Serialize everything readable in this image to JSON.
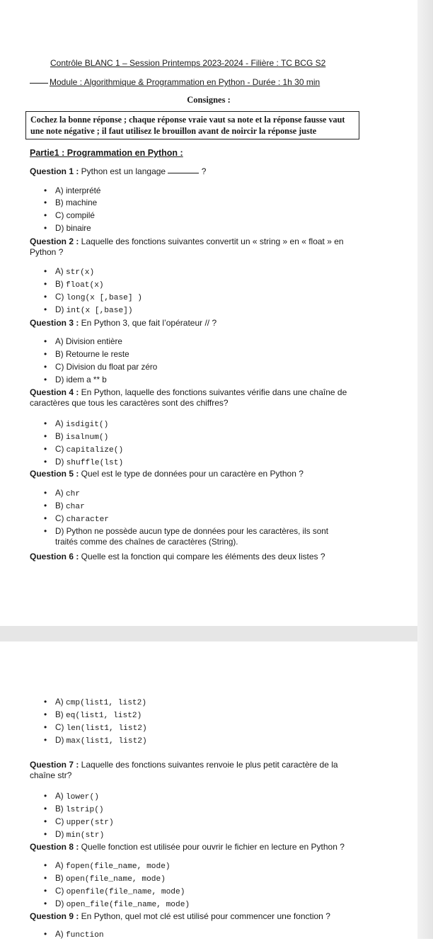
{
  "header": {
    "line1": "Contrôle BLANC 1 – Session Printemps 2023-2024 - Filière : TC BCG S2",
    "line2": "Module : Algorithmique & Programmation en Python - Durée : 1h 30 min",
    "consignes_title": "Consignes :",
    "consignes_text": "Cochez la bonne réponse ; chaque réponse vraie vaut sa note et la réponse fausse vaut une note négative ; il faut utilisez le brouillon avant de noircir la réponse juste"
  },
  "part_title": "Partie1 : Programmation en Python :",
  "questions": [
    {
      "label": "Question 1 :",
      "text_a": " Python est un langage",
      "text_b": " ?",
      "options": [
        {
          "prefix": "A) ",
          "text": "interprété"
        },
        {
          "prefix": "B) ",
          "text": "machine"
        },
        {
          "prefix": "C) ",
          "text": "compilé"
        },
        {
          "prefix": "D) ",
          "text": "binaire"
        }
      ]
    },
    {
      "label": "Question 2 :",
      "text": " Laquelle des fonctions suivantes convertit un « string » en « float » en Python ?",
      "options": [
        {
          "prefix": "A) ",
          "text": "str(x)"
        },
        {
          "prefix": "B) ",
          "text": "float(x)"
        },
        {
          "prefix": "C) ",
          "text": "long(x [,base] )"
        },
        {
          "prefix": "D) ",
          "text": "int(x [,base])"
        }
      ]
    },
    {
      "label": "Question 3 :",
      "text": " En Python 3, que fait l’opérateur // ?",
      "options": [
        {
          "prefix": "A) ",
          "text": "Division entière"
        },
        {
          "prefix": "B) ",
          "text": "Retourne le reste"
        },
        {
          "prefix": "C) ",
          "text": "Division du float par zéro"
        },
        {
          "prefix": "D) ",
          "text": "idem a ** b"
        }
      ]
    },
    {
      "label": "Question 4 :",
      "text": " En Python, laquelle des fonctions suivantes vérifie dans une chaîne de caractères que tous les caractères sont des chiffres?",
      "options": [
        {
          "prefix": "A) ",
          "text": "isdigit()"
        },
        {
          "prefix": "B) ",
          "text": "isalnum()"
        },
        {
          "prefix": "C) ",
          "text": "capitalize()"
        },
        {
          "prefix": "D) ",
          "text": "shuffle(lst)"
        }
      ]
    },
    {
      "label": "Question 5 :",
      "text": " Quel est le type de données pour un caractère en Python ?",
      "options": [
        {
          "prefix": "A) ",
          "text": "chr"
        },
        {
          "prefix": "B) ",
          "text": "char"
        },
        {
          "prefix": "C) ",
          "text": "character"
        },
        {
          "prefix": "D) ",
          "text": "Python ne possède aucun type de données pour les caractères, ils sont",
          "cont": "traités comme des chaînes de caractères (String)."
        }
      ]
    },
    {
      "label": "Question 6 :",
      "text": " Quelle est la fonction qui compare les éléments des deux listes ?",
      "options": [
        {
          "prefix": "A) ",
          "text": "cmp(list1, list2)"
        },
        {
          "prefix": "B) ",
          "text": "eq(list1, list2)"
        },
        {
          "prefix": "C) ",
          "text": "len(list1, list2)"
        },
        {
          "prefix": "D) ",
          "text": "max(list1, list2)"
        }
      ]
    },
    {
      "label": "Question 7 :",
      "text": " Laquelle des fonctions suivantes renvoie le plus petit caractère de la chaîne str?",
      "options": [
        {
          "prefix": "A) ",
          "text": "lower()"
        },
        {
          "prefix": "B) ",
          "text": "lstrip()"
        },
        {
          "prefix": "C) ",
          "text": "upper(str)"
        },
        {
          "prefix": "D) ",
          "text": "min(str)"
        }
      ]
    },
    {
      "label": "Question 8 :",
      "text": " Quelle fonction est utilisée pour ouvrir le fichier en lecture en Python ?",
      "options": [
        {
          "prefix": "A) ",
          "text": "fopen(file_name, mode)"
        },
        {
          "prefix": "B) ",
          "text": "open(file_name, mode)"
        },
        {
          "prefix": "C) ",
          "text": "openfile(file_name, mode)"
        },
        {
          "prefix": "D) ",
          "text": "open_file(file_name, mode)"
        }
      ]
    },
    {
      "label": "Question 9 :",
      "text": " En Python, quel mot clé est utilisé pour commencer une fonction ?",
      "options": [
        {
          "prefix": "A) ",
          "text": "function"
        }
      ]
    }
  ]
}
